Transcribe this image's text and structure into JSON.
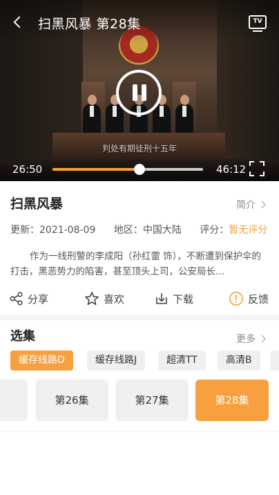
{
  "player": {
    "title": "扫黑风暴 第28集",
    "tv_label": "TV",
    "subtitle": "判处有期徒刑十五年",
    "current_time": "26:50",
    "total_time": "46:12",
    "progress": 0.58
  },
  "info": {
    "title": "扫黑风暴",
    "intro_label": "简介",
    "update_label": "更新：",
    "update_value": "2021-08-09",
    "region_label": "地区：",
    "region_value": "中国大陆",
    "rating_label": "评分：",
    "rating_value": "暂无评分",
    "description": "作为一线刑警的李成阳（孙红雷 饰），不断遭到保护伞的打击，黑恶势力的陷害，甚至顶头上司，公安局长…"
  },
  "actions": {
    "share": "分享",
    "like": "喜欢",
    "download": "下载",
    "feedback": "反馈"
  },
  "episodes_section": {
    "title": "选集",
    "more_label": "更多",
    "sources": [
      "缓存线路D",
      "缓存线路J",
      "超清TT",
      "高清B"
    ],
    "active_source": 0,
    "episodes": [
      "第26集",
      "第27集",
      "第28集"
    ],
    "active_episode": 2
  },
  "colors": {
    "accent": "#f8a03f"
  }
}
